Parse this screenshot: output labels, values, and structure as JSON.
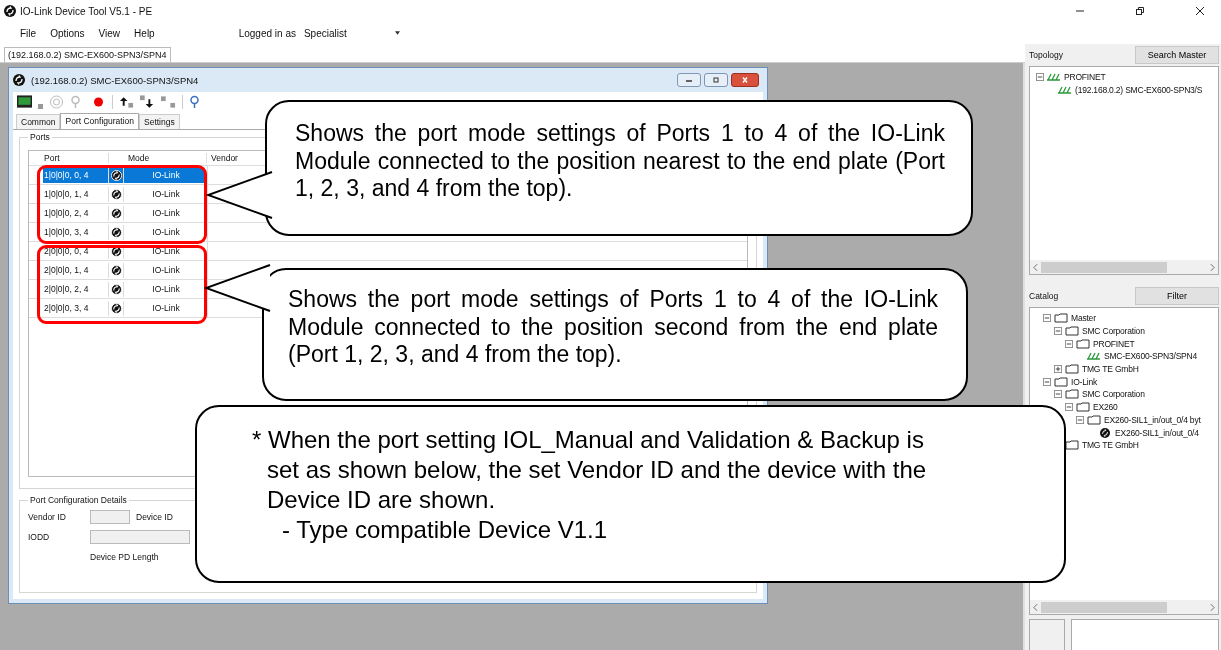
{
  "window": {
    "title": "IO-Link Device Tool V5.1 - PE"
  },
  "menu": [
    "File",
    "Options",
    "View",
    "Help"
  ],
  "login": {
    "label": "Logged in as",
    "value": "Specialist"
  },
  "document_tab": "(192.168.0.2) SMC-EX600-SPN3/SPN4",
  "device_window": {
    "title": "(192.168.0.2) SMC-EX600-SPN3/SPN4",
    "tabs": [
      {
        "label": "Common",
        "selected": false
      },
      {
        "label": "Port Configuration",
        "selected": true
      },
      {
        "label": "Settings",
        "selected": false
      }
    ],
    "ports": {
      "title": "Ports",
      "columns": [
        "Port",
        "Mode",
        "Vendor"
      ],
      "rows": [
        {
          "port": "1|0|0|0, 0, 4",
          "mode": "IO-Link",
          "selected": true
        },
        {
          "port": "1|0|0|0, 1, 4",
          "mode": "IO-Link",
          "selected": false
        },
        {
          "port": "1|0|0|0, 2, 4",
          "mode": "IO-Link",
          "selected": false
        },
        {
          "port": "1|0|0|0, 3, 4",
          "mode": "IO-Link",
          "selected": false
        },
        {
          "port": "2|0|0|0, 0, 4",
          "mode": "IO-Link",
          "selected": false
        },
        {
          "port": "2|0|0|0, 1, 4",
          "mode": "IO-Link",
          "selected": false
        },
        {
          "port": "2|0|0|0, 2, 4",
          "mode": "IO-Link",
          "selected": false
        },
        {
          "port": "2|0|0|0, 3, 4",
          "mode": "IO-Link",
          "selected": false
        }
      ]
    },
    "details": {
      "title": "Port Configuration Details",
      "vendor_id_label": "Vendor ID",
      "device_id_label": "Device ID",
      "iodd_label": "IODD",
      "pd_length_label": "Device PD Length"
    }
  },
  "topology": {
    "title": "Topology",
    "button": "Search Master",
    "items": [
      {
        "label": "PROFINET",
        "kind": "profinet",
        "expanded": true,
        "children": [
          {
            "label": "(192.168.0.2) SMC-EX600-SPN3/S",
            "kind": "profinet"
          }
        ]
      }
    ]
  },
  "catalog": {
    "title": "Catalog",
    "button": "Filter",
    "items": [
      {
        "label": "Master",
        "kind": "folder",
        "expanded": true,
        "children": [
          {
            "label": "SMC Corporation",
            "kind": "folder",
            "expanded": true,
            "children": [
              {
                "label": "PROFINET",
                "kind": "folder",
                "expanded": true,
                "children": [
                  {
                    "label": "SMC-EX600-SPN3/SPN4",
                    "kind": "profinet"
                  }
                ]
              }
            ]
          },
          {
            "label": "TMG TE GmbH",
            "kind": "folder",
            "expanded": false
          }
        ]
      },
      {
        "label": "IO-Link",
        "kind": "folder",
        "expanded": true,
        "children": [
          {
            "label": "SMC Corporation",
            "kind": "folder",
            "expanded": true,
            "children": [
              {
                "label": "EX260",
                "kind": "folder",
                "expanded": true,
                "children": [
                  {
                    "label": "EX260-SIL1_in/out_0/4 byt",
                    "kind": "folder",
                    "expanded": true,
                    "children": [
                      {
                        "label": "EX260-SIL1_in/out_0/4",
                        "kind": "iolink"
                      }
                    ]
                  }
                ]
              }
            ]
          },
          {
            "label": "TMG TE GmbH",
            "kind": "folder"
          }
        ]
      }
    ]
  },
  "callouts": [
    {
      "kind": "pointer",
      "paragraphs": [
        "Shows the port mode settings of Ports 1 to 4 of the IO-Link Module connected to the position nearest to the end plate (Port 1, 2, 3, and 4 from the top)."
      ]
    },
    {
      "kind": "pointer",
      "paragraphs": [
        "Shows the port mode settings of Ports 1 to 4 of the IO-Link Module connected to the position second from the end plate (Port 1, 2, 3, and 4 from the top)."
      ]
    },
    {
      "kind": "note",
      "paragraphs": [
        "* When the port setting IOL_Manual and Validation & Backup is set as shown below, the set Vendor ID and the device with the Device ID are shown.",
        "- Type compatible Device V1.1"
      ]
    }
  ]
}
